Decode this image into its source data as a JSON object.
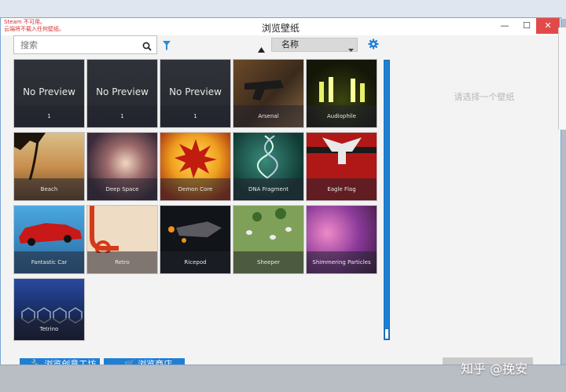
{
  "window": {
    "title": "浏览壁纸",
    "warning_line1": "Steam 不可用。",
    "warning_line2": "云端将不载入任何壁纸。",
    "controls": {
      "minimize": "—",
      "maximize": "☐",
      "close": "✕"
    }
  },
  "toolbar": {
    "search_placeholder": "搜索",
    "sort_label": "名称",
    "colors": {
      "accent": "#1f7ed6",
      "filter": "#2a8cd8"
    }
  },
  "wallpapers": [
    {
      "name": "No Preview",
      "count": "1",
      "type": "no-preview"
    },
    {
      "name": "No Preview",
      "count": "1",
      "type": "no-preview"
    },
    {
      "name": "No Preview",
      "count": "1",
      "type": "no-preview"
    },
    {
      "name": "Arsenal",
      "type": "image"
    },
    {
      "name": "Audiophile",
      "type": "image"
    },
    {
      "name": "Beach",
      "type": "image"
    },
    {
      "name": "Deep Space",
      "type": "image"
    },
    {
      "name": "Demon Core",
      "type": "image"
    },
    {
      "name": "DNA Fragment",
      "type": "image"
    },
    {
      "name": "Eagle Flag",
      "type": "image"
    },
    {
      "name": "Fantastic Car",
      "type": "image"
    },
    {
      "name": "Retro",
      "type": "image"
    },
    {
      "name": "Ricepod",
      "type": "image"
    },
    {
      "name": "Sheeper",
      "type": "image"
    },
    {
      "name": "Shimmering Particles",
      "type": "image"
    },
    {
      "name": "Tetrino",
      "type": "image"
    }
  ],
  "detail": {
    "hint": "请选择一个壁纸"
  },
  "bottom": {
    "workshop_button": "浏览创意工坊",
    "store_button": "浏览商店"
  },
  "watermark": "知乎 @挽安"
}
